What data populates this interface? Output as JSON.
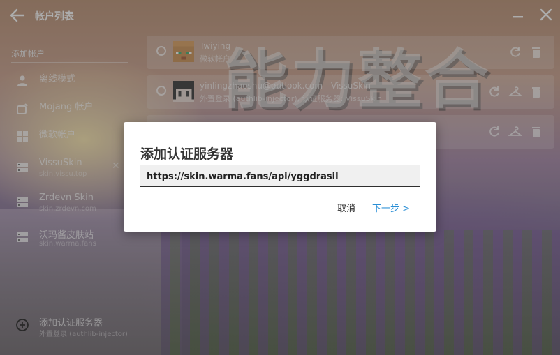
{
  "window": {
    "title": "帐户列表",
    "back_icon": "arrow-left-icon",
    "minimize_icon": "minimize-icon",
    "close_icon": "close-icon"
  },
  "sidebar": {
    "header": "添加帐户",
    "items": [
      {
        "label": "离线模式",
        "sub": "",
        "icon": "person-icon"
      },
      {
        "label": "Mojang 帐户",
        "sub": "",
        "icon": "mojang-icon"
      },
      {
        "label": "微软帐户",
        "sub": "",
        "icon": "windows-icon"
      },
      {
        "label": "VissuSkin",
        "sub": "skin.vissu.top",
        "icon": "server-icon",
        "removable": true
      },
      {
        "label": "Zrdevn Skin",
        "sub": "skin.zrdevn.com",
        "icon": "server-icon"
      },
      {
        "label": "沃玛酱皮肤站",
        "sub": "skin.warma.fans",
        "icon": "server-icon"
      }
    ],
    "add_server": {
      "label": "添加认证服务器",
      "sub": "外置登录 (authlib-injector)",
      "icon": "plus-circle-icon"
    }
  },
  "accounts": [
    {
      "name": "Twiying",
      "sub": "微软帐户",
      "avatar": "player-head-icon",
      "actions": [
        "refresh-icon",
        "delete-icon"
      ]
    },
    {
      "name": "yinlingzhaoshu@outlook.com - VissuSkin",
      "sub": "外置登录 (authlib-injector), 认证服务器: VissuSkin",
      "avatar": "skin-face-icon",
      "actions": [
        "refresh-icon",
        "hanger-icon",
        "delete-icon"
      ]
    },
    {
      "name": "",
      "sub": "",
      "avatar": "",
      "actions": [
        "refresh-icon",
        "hanger-icon",
        "delete-icon"
      ]
    }
  ],
  "background_art_text": "能力整合",
  "dialog": {
    "title": "添加认证服务器",
    "input_value": "https://skin.warma.fans/api/yggdrasil",
    "cancel_label": "取消",
    "next_label": "下一步 >"
  },
  "colors": {
    "accent": "#2a8fd6",
    "input_underline": "#2f2f2f",
    "dialog_bg": "#ffffff"
  }
}
